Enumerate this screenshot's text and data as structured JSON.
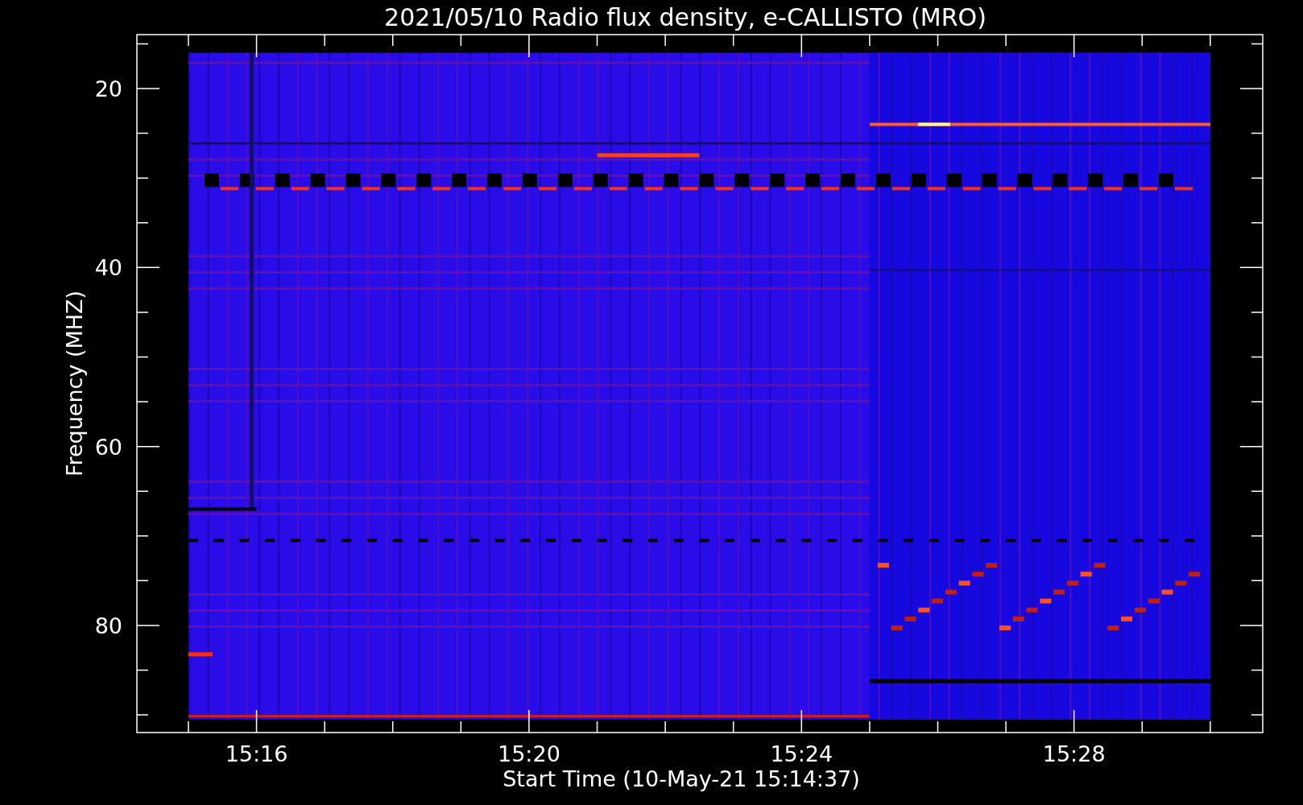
{
  "title": "2021/05/10  Radio flux density, e-CALLISTO (MRO)",
  "y_axis": {
    "label": "Frequency (MHZ)",
    "ticks": [
      "20",
      "40",
      "60",
      "80"
    ]
  },
  "x_axis": {
    "label": "Start Time (10-May-21 15:14:37)",
    "ticks": [
      "15:16",
      "15:20",
      "15:24",
      "15:28"
    ]
  }
}
